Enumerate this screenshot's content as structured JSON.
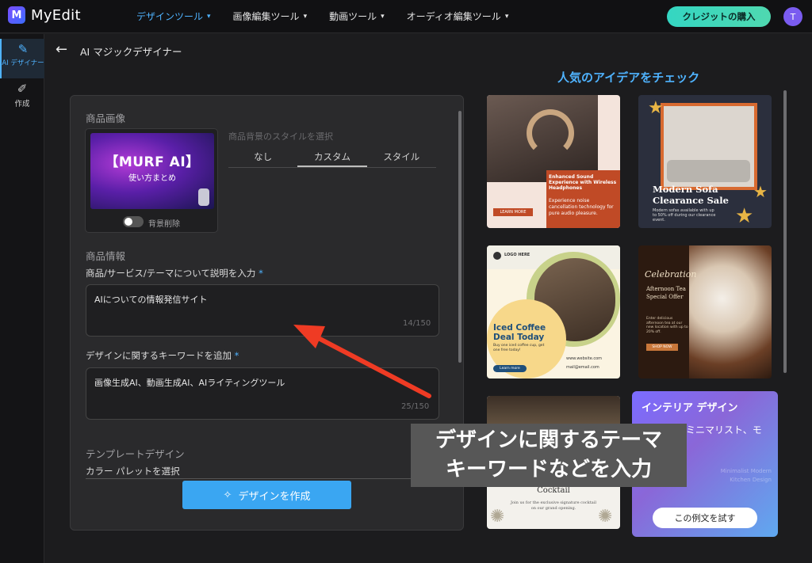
{
  "app": {
    "logo_mark": "M",
    "name": "MyEdit"
  },
  "nav": [
    {
      "label": "デザインツール",
      "active": true
    },
    {
      "label": "画像編集ツール",
      "active": false
    },
    {
      "label": "動画ツール",
      "active": false
    },
    {
      "label": "オーディオ編集ツール",
      "active": false
    }
  ],
  "header": {
    "buy_label": "クレジットの購入",
    "avatar_initial": "T"
  },
  "sidebar": [
    {
      "label": "AI デザイナー",
      "icon": "magic-wand-icon",
      "active": true
    },
    {
      "label": "作成",
      "icon": "pencil-icon",
      "active": false
    }
  ],
  "page": {
    "back_icon": "arrow-left-icon",
    "title": "AI マジックデザイナー"
  },
  "form": {
    "product_image_title": "商品画像",
    "thumb_line1": "【MURF AI】",
    "thumb_line2": "使い方まとめ",
    "bg_remove_label": "背景削除",
    "bg_style_label": "商品背景のスタイルを選択",
    "tabs": [
      {
        "label": "なし",
        "active": false
      },
      {
        "label": "カスタム",
        "active": true
      },
      {
        "label": "スタイル",
        "active": false
      }
    ],
    "product_info_title": "商品情報",
    "desc_label": "商品/サービス/テーマについて説明を入力",
    "required_mark": "*",
    "desc_value": "AIについての情報発信サイト",
    "desc_counter": "14/150",
    "keyword_label": "デザインに関するキーワードを追加",
    "keyword_value": "画像生成AI、動画生成AI、AIライティングツール",
    "keyword_counter": "25/150",
    "template_title": "テンプレートデザイン",
    "palette_label": "カラー パレットを選択",
    "create_label": "デザインを作成"
  },
  "ideas": {
    "title": "人気のアイデアをチェック",
    "cards": [
      {
        "title": "Enhanced Sound Experience with Wireless Headphones",
        "body": "Experience noise cancellation technology for pure audio pleasure.",
        "button": "LEARN MORE"
      },
      {
        "title": "Modern Sofa Clearance Sale",
        "body": "Modern sofas available with up to 50% off during our clearance event."
      },
      {
        "logo": "LOGO HERE",
        "title": "Iced Coffee Deal Today",
        "body": "Buy one iced coffee cup, get one free today!",
        "button": "Learn more",
        "website": "www.website.com",
        "email": "mail@email.com"
      },
      {
        "script": "Celebration",
        "title": "Afternoon Tea Special Offer",
        "body": "Enter delicious afternoon tea at our new location with up to 20% off.",
        "button": "SHOP NOW"
      },
      {
        "title": "New Exclusive Signature Cocktail",
        "body": "Join us for the exclusive signature cocktail on our grand opening."
      }
    ],
    "interior": {
      "title": "インテリア デザイン",
      "text": "ミニマリスト、モ",
      "faded": "Minimalist Modern Kitchen Design",
      "button": "この例文を試す"
    }
  },
  "annotation": {
    "line1": "デザインに関するテーマ",
    "line2": "キーワードなどを入力"
  },
  "colors": {
    "accent": "#4fb3ff",
    "buy_button": "#34d6c2",
    "create_button": "#3aa6f2",
    "arrow": "#ef3b24"
  }
}
